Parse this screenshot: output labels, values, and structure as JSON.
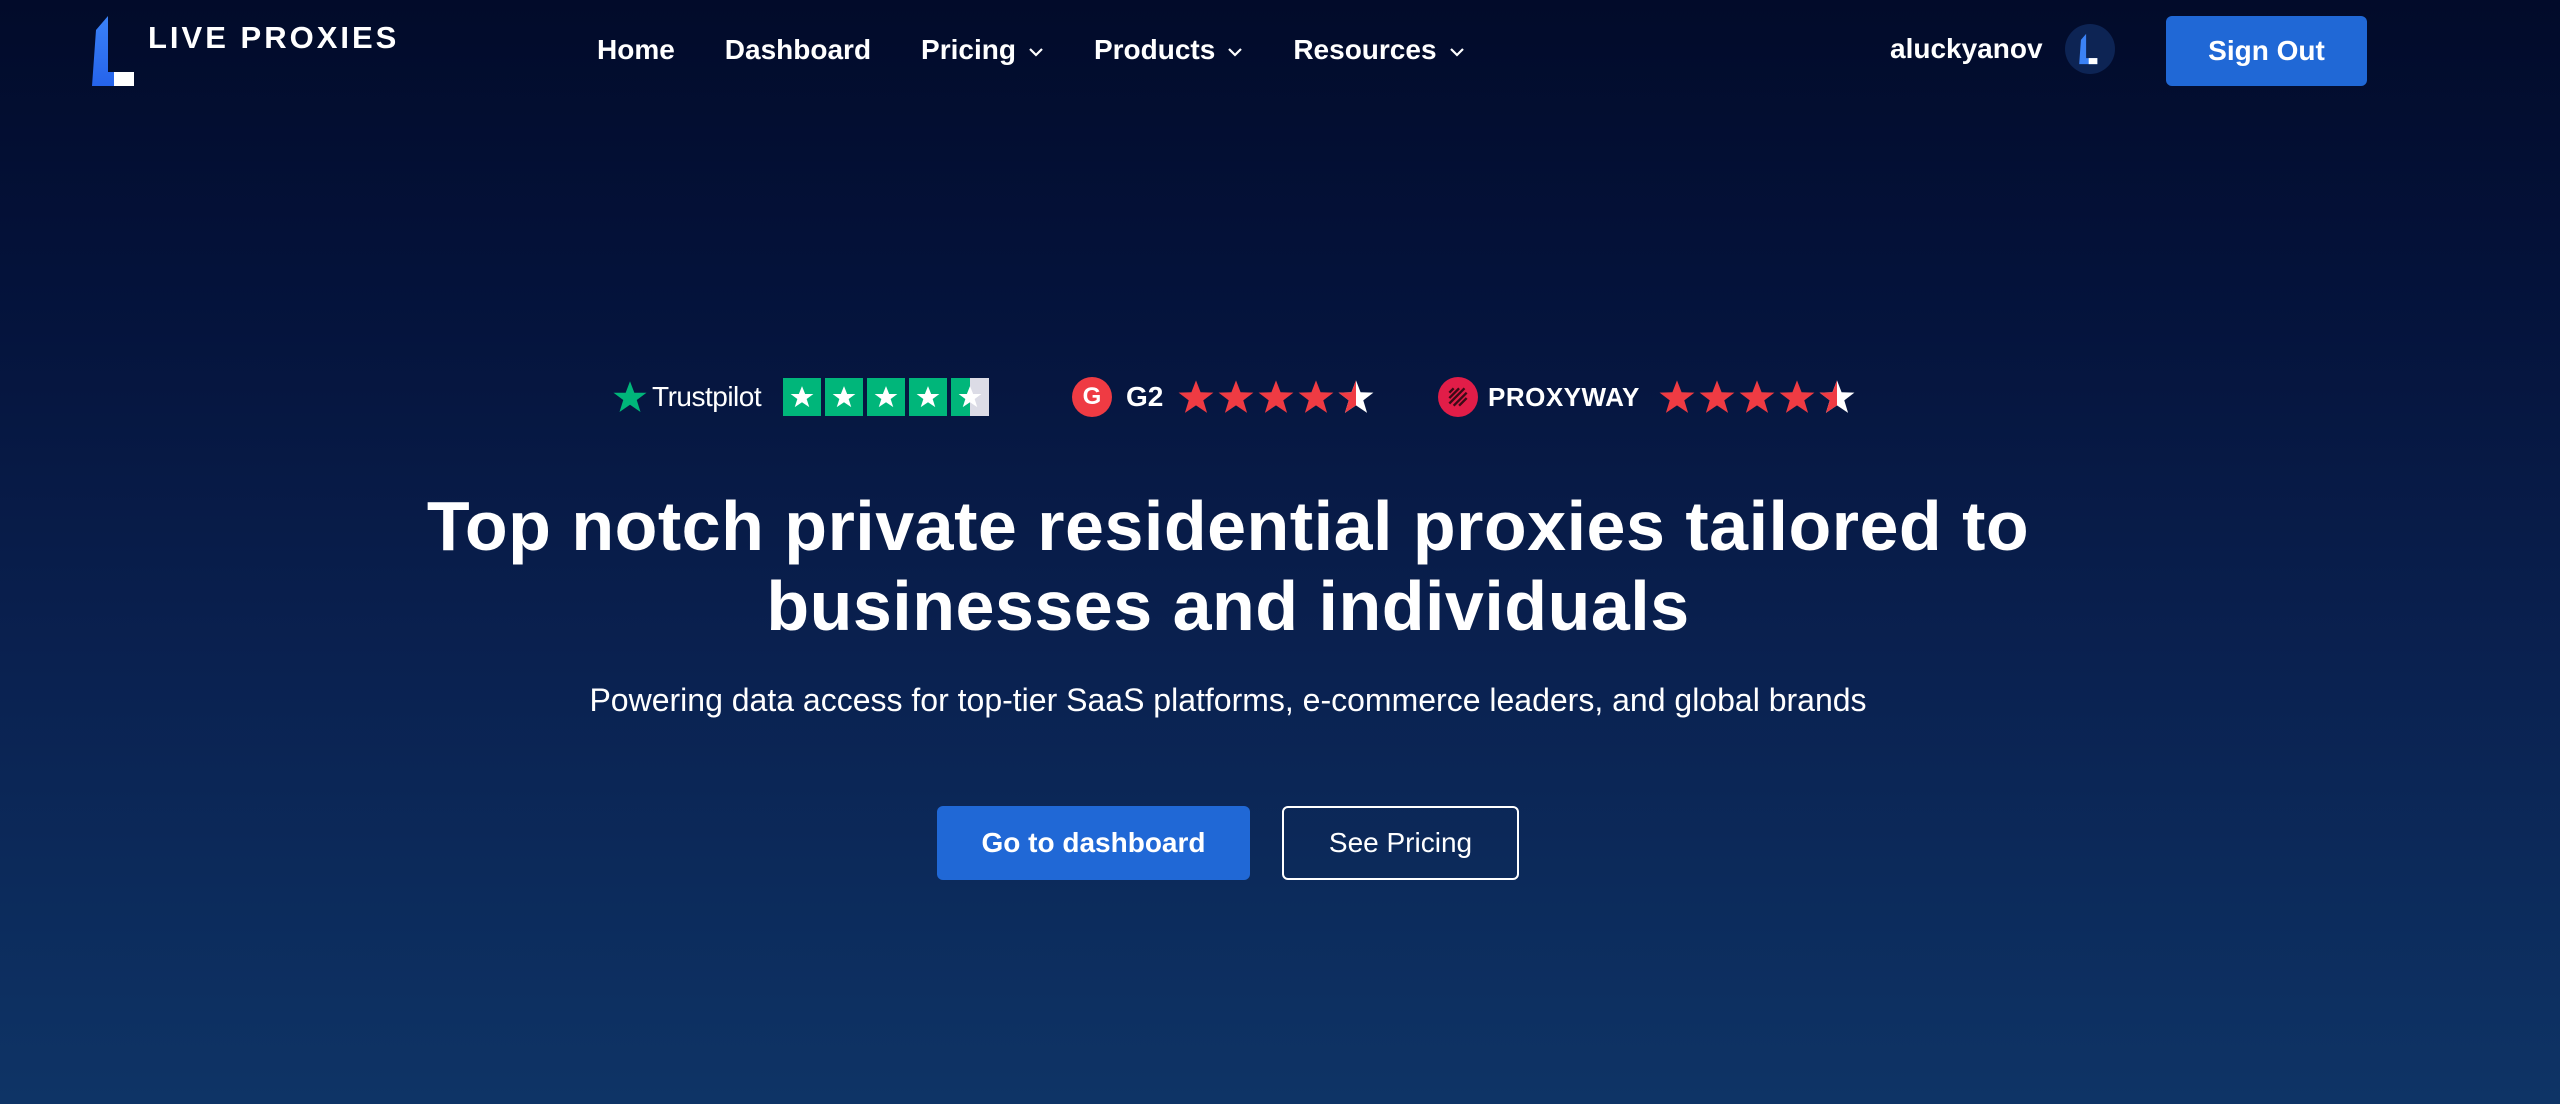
{
  "header": {
    "logo_text": "LIVE PROXIES",
    "nav": [
      {
        "label": "Home",
        "has_dropdown": false
      },
      {
        "label": "Dashboard",
        "has_dropdown": false
      },
      {
        "label": "Pricing",
        "has_dropdown": true
      },
      {
        "label": "Products",
        "has_dropdown": true
      },
      {
        "label": "Resources",
        "has_dropdown": true
      }
    ],
    "username": "aluckyanov",
    "sign_out_label": "Sign Out"
  },
  "ratings": {
    "trustpilot": {
      "label": "Trustpilot",
      "stars": 4.5,
      "star_color": "#00b67a"
    },
    "g2": {
      "badge": "G",
      "label": "G2",
      "stars": 4.5,
      "star_color": "#ef3b43"
    },
    "proxyway": {
      "label": "PROXYWAY",
      "stars": 4.5,
      "star_color": "#ef3b43"
    }
  },
  "hero": {
    "title": "Top notch private residential proxies tailored to businesses and individuals",
    "subtitle": "Powering data access for top-tier SaaS platforms, e-commerce leaders, and global brands",
    "primary_cta": "Go to dashboard",
    "secondary_cta": "See Pricing"
  },
  "colors": {
    "accent": "#2068d6",
    "background_top": "#020b2a",
    "background_bottom": "#0e3466"
  }
}
